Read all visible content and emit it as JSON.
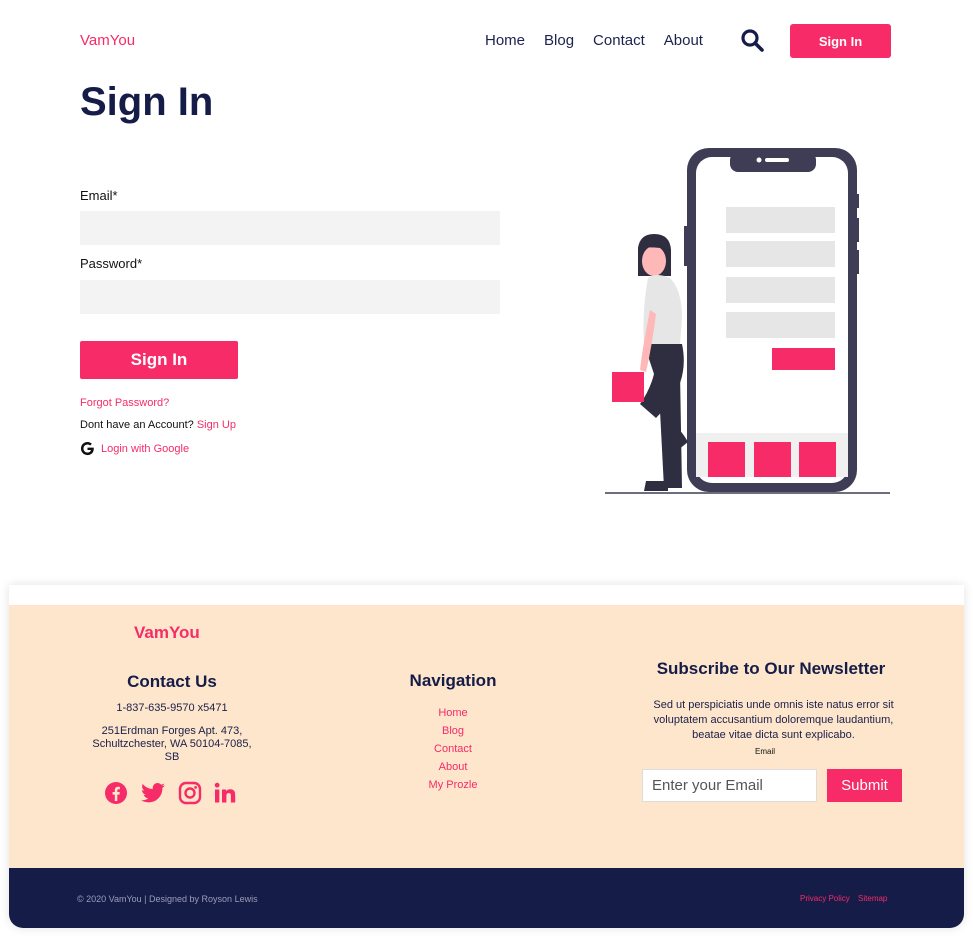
{
  "header": {
    "brand": "VamYou",
    "nav": [
      "Home",
      "Blog",
      "Contact",
      "About"
    ],
    "search_icon": "search-icon",
    "signin_label": "Sign In"
  },
  "main": {
    "title": "Sign In",
    "email_label": "Email*",
    "email_value": "",
    "password_label": "Password*",
    "password_value": "",
    "signin_button": "Sign In",
    "forgot": "Forgot Password?",
    "no_account": "Dont have an Account?",
    "signup": "Sign Up",
    "google": "Login with Google"
  },
  "footer": {
    "brand": "VamYou",
    "contact_title": "Contact Us",
    "phone": "1-837-635-9570 x5471",
    "address": "251Erdman Forges Apt. 473, Schultzchester, WA 50104-7085, SB",
    "social_icons": [
      "facebook-icon",
      "twitter-icon",
      "instagram-icon",
      "linkedin-icon"
    ],
    "nav_title": "Navigation",
    "nav_links": [
      "Home",
      "Blog",
      "Contact",
      "About",
      "My Prozle"
    ],
    "newsletter_title": "Subscribe to Our Newsletter",
    "newsletter_text": "Sed ut perspiciatis unde omnis iste natus error sit voluptatem accusantium doloremque laudantium, beatae vitae dicta sunt explicabo.",
    "email_small_label": "Email",
    "email_placeholder": "Enter your Email",
    "submit": "Submit",
    "copyright": "© 2020 VamYou | Designed by Royson Lewis",
    "privacy": "Privacy Policy",
    "sitemap": "Sitemap"
  },
  "colors": {
    "accent": "#f62b68",
    "navy": "#151c48",
    "footer_bg": "#fde6cb",
    "input_bg": "#f3f3f3"
  }
}
